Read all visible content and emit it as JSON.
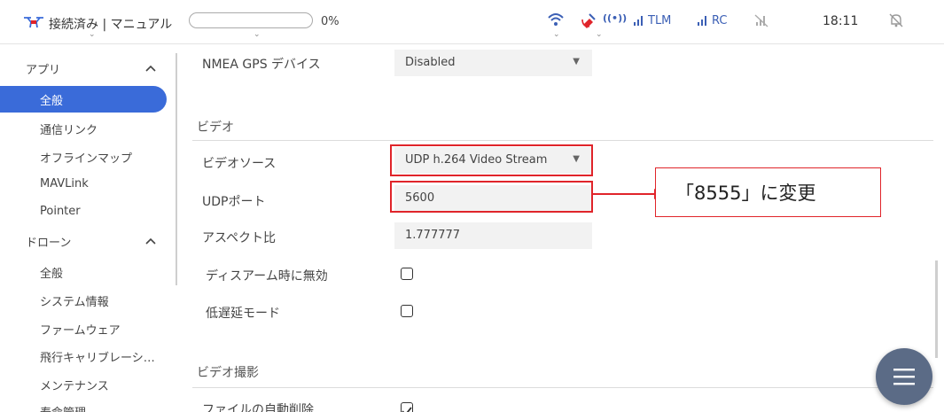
{
  "toolbar": {
    "connection_label": "接続済み | マニュアル",
    "progress_percent": 0,
    "progress_text": "0%",
    "tlm_label": "TLM",
    "rc_label": "RC",
    "radio_text": "((•))",
    "clock": "18:11"
  },
  "sidebar": {
    "groups": [
      {
        "label": "アプリ",
        "items": [
          "全般",
          "通信リンク",
          "オフラインマップ",
          "MAVLink",
          "Pointer"
        ]
      },
      {
        "label": "ドローン",
        "items": [
          "全般",
          "システム情報",
          "ファームウェア",
          "飛行キャリブレーシ…",
          "メンテナンス",
          "寿命管理"
        ]
      }
    ],
    "active_item": "全般"
  },
  "main": {
    "nmea": {
      "label": "NMEA GPS デバイス",
      "value": "Disabled"
    },
    "video_section": {
      "title": "ビデオ",
      "source": {
        "label": "ビデオソース",
        "value": "UDP h.264 Video Stream"
      },
      "udp_port": {
        "label": "UDPポート",
        "value": "5600"
      },
      "aspect": {
        "label": "アスペクト比",
        "value": "1.777777"
      },
      "disable_on_disarm": {
        "label": "ディスアーム時に無効",
        "checked": false
      },
      "low_latency": {
        "label": "低遅延モード",
        "checked": false
      }
    },
    "recording_section": {
      "title": "ビデオ撮影",
      "auto_delete": {
        "label": "ファイルの自動削除",
        "checked": true
      }
    }
  },
  "annotation": {
    "text": "「8555」に変更"
  },
  "colors": {
    "accent": "#3a6bd9",
    "highlight": "#e0242a",
    "signal": "#3b5fb5",
    "fab": "#5b6b86"
  },
  "icons": {
    "drone": "drone-icon",
    "wifi": "wifi-icon",
    "satellite": "satellite-icon",
    "signal": "signal-bars-icon",
    "no_signal": "no-signal-icon",
    "bell": "bell-muted-icon",
    "menu": "hamburger-menu-icon"
  }
}
